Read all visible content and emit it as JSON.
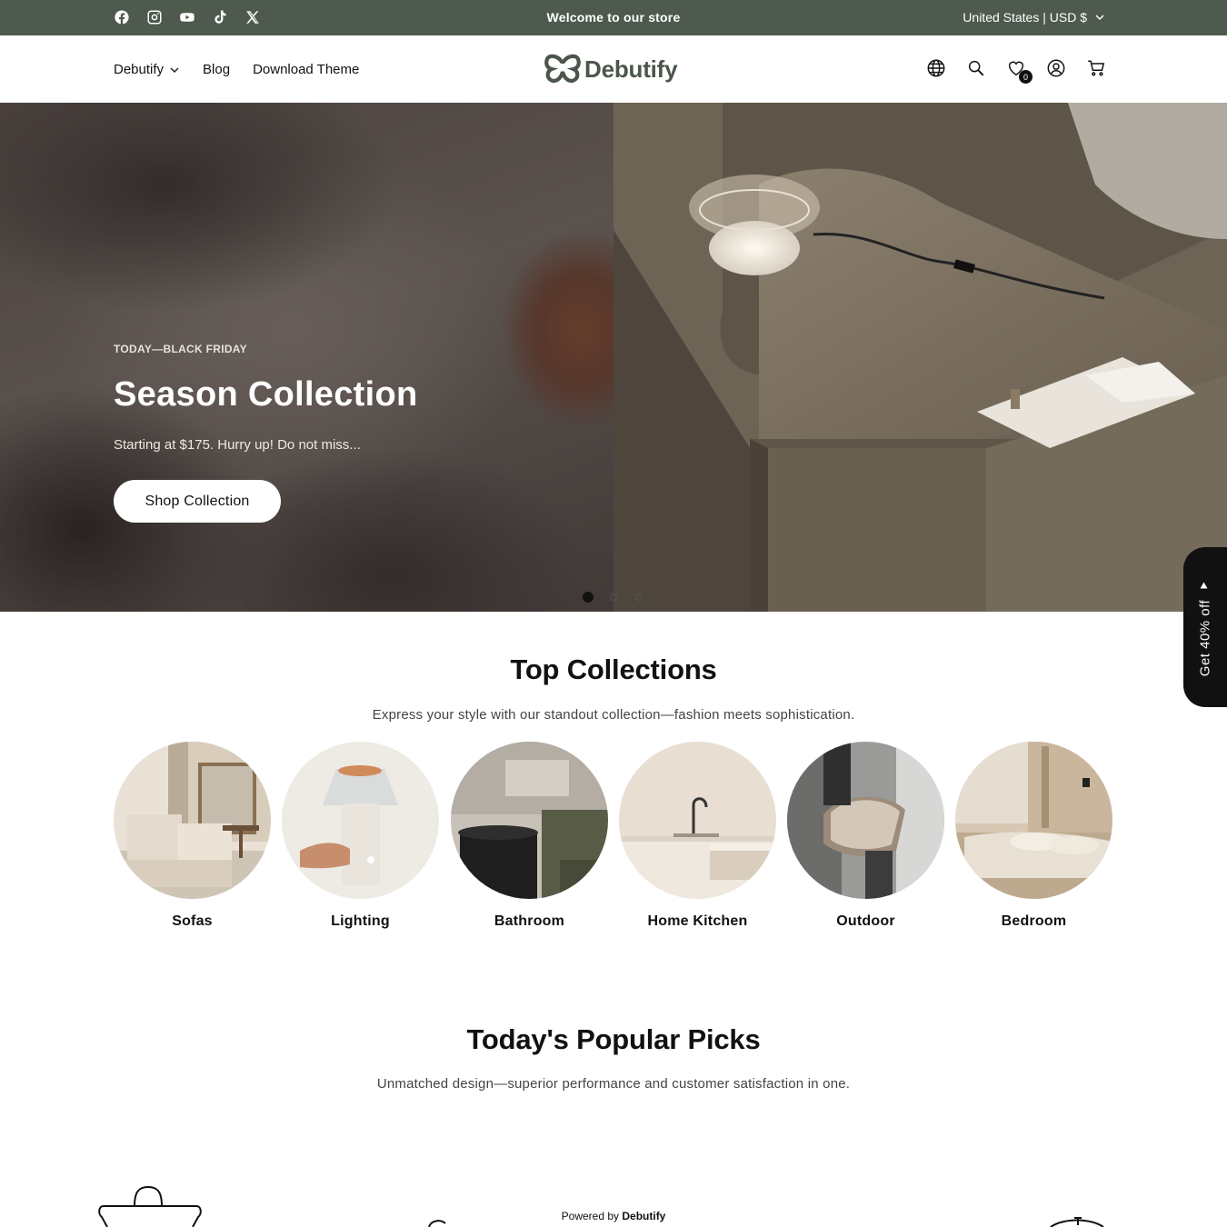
{
  "announcement": {
    "text": "Welcome to our store",
    "locale": "United States | USD $",
    "social": [
      "facebook-icon",
      "instagram-icon",
      "youtube-icon",
      "tiktok-icon",
      "x-icon"
    ]
  },
  "header": {
    "nav": [
      {
        "label": "Debutify",
        "has_dropdown": true
      },
      {
        "label": "Blog"
      },
      {
        "label": "Download Theme"
      }
    ],
    "logo_text": "Debutify",
    "icons": [
      "globe-icon",
      "search-icon",
      "wishlist-icon",
      "account-icon",
      "cart-icon"
    ],
    "wishlist_count": "0"
  },
  "hero": {
    "eyebrow": "TODAY—BLACK FRIDAY",
    "title": "Season Collection",
    "subtitle": "Starting at $175. Hurry up! Do not miss...",
    "button": "Shop Collection",
    "slides": 3,
    "active_slide": 1
  },
  "side_tab": {
    "label": "Get 40% off"
  },
  "top_collections": {
    "title": "Top Collections",
    "subtitle": "Express your style with our standout collection—fashion meets sophistication.",
    "items": [
      {
        "label": "Sofas"
      },
      {
        "label": "Lighting"
      },
      {
        "label": "Bathroom"
      },
      {
        "label": "Home Kitchen"
      },
      {
        "label": "Outdoor"
      },
      {
        "label": "Bedroom"
      }
    ]
  },
  "popular": {
    "title": "Today's Popular Picks",
    "subtitle": "Unmatched design—superior performance and customer satisfaction in one."
  },
  "powered": {
    "prefix": "Powered by",
    "brand": "Debutify"
  },
  "colors": {
    "announce_bg": "#4d5a4d",
    "logo": "#4a564a",
    "accent": "#111111"
  }
}
